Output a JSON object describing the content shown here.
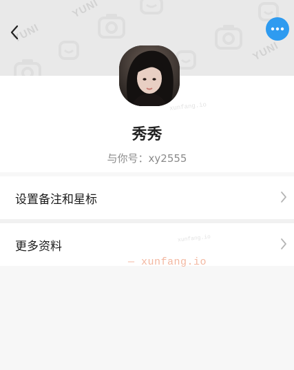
{
  "header": {
    "back_icon": "chevron-left-icon",
    "more_icon": "more-horizontal-icon",
    "more_color": "#2e9bf0",
    "pattern_text": "YUNI"
  },
  "profile": {
    "name": "秀秀",
    "account_line": "与你号：xy2555"
  },
  "menu": {
    "items": [
      {
        "label": "设置备注和星标"
      },
      {
        "label": "更多资料"
      }
    ]
  },
  "watermark": {
    "main": "— xunfang.io",
    "small": "xunfang.io",
    "tiny": "xunfang.io"
  }
}
